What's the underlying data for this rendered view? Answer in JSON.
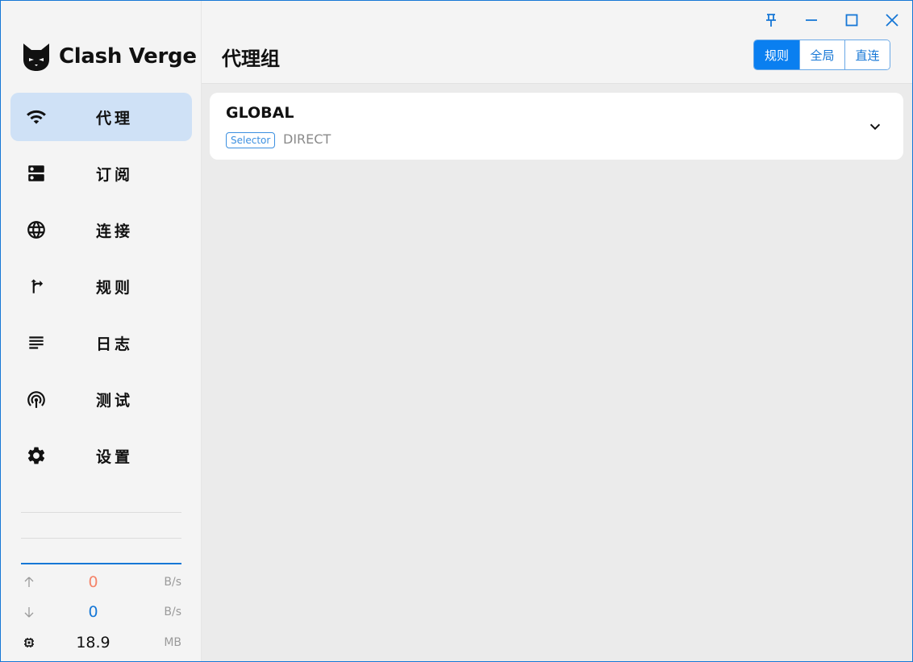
{
  "app": {
    "name": "Clash Verge",
    "accent": "#0a7ff0"
  },
  "sidebar": {
    "items": [
      {
        "label": "代理",
        "icon": "wifi-icon",
        "active": true
      },
      {
        "label": "订阅",
        "icon": "dns-icon",
        "active": false
      },
      {
        "label": "连接",
        "icon": "globe-icon",
        "active": false
      },
      {
        "label": "规则",
        "icon": "fork-right-icon",
        "active": false
      },
      {
        "label": "日志",
        "icon": "subject-icon",
        "active": false
      },
      {
        "label": "测试",
        "icon": "broadcast-icon",
        "active": false
      },
      {
        "label": "设置",
        "icon": "gear-icon",
        "active": false
      }
    ],
    "traffic": {
      "upload": {
        "value": "0",
        "unit": "B/s",
        "color": "#f4846a"
      },
      "download": {
        "value": "0",
        "unit": "B/s",
        "color": "#1677d6"
      },
      "memory": {
        "value": "18.9",
        "unit": "MB"
      }
    }
  },
  "header": {
    "title": "代理组",
    "modes": [
      {
        "label": "规则",
        "active": true
      },
      {
        "label": "全局",
        "active": false
      },
      {
        "label": "直连",
        "active": false
      }
    ]
  },
  "groups": [
    {
      "name": "GLOBAL",
      "type": "Selector",
      "now": "DIRECT"
    }
  ]
}
